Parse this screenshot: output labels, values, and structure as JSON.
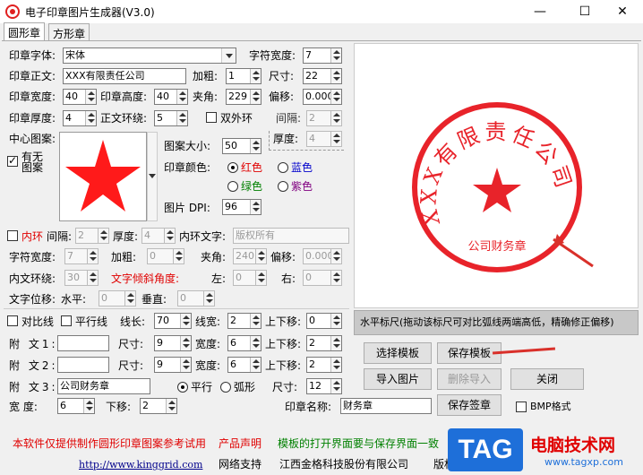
{
  "window": {
    "title": "电子印章图片生成器(V3.0)",
    "minimize": "—",
    "maximize": "☐",
    "close": "✕"
  },
  "tabs": [
    "圆形章",
    "方形章"
  ],
  "row1": {
    "font_label": "印章字体:",
    "font_value": "宋体",
    "charwidth_label": "字符宽度:",
    "charwidth_value": "7"
  },
  "row2": {
    "text_label": "印章正文:",
    "text_value": "XXX有限责任公司",
    "bold_label": "加粗:",
    "bold_value": "1",
    "size_label": "尺寸:",
    "size_value": "22"
  },
  "row3": {
    "width_label": "印章宽度:",
    "width_value": "40",
    "height_label": "印章高度:",
    "height_value": "40",
    "angle_label": "夹角:",
    "angle_value": "229",
    "offset_label": "偏移:",
    "offset_value": "0.000"
  },
  "row4": {
    "thick_label": "印章厚度:",
    "thick_value": "4",
    "ring_label": "正文环绕:",
    "ring_value": "5",
    "double_label": "双外环",
    "gap_label": "间隔:",
    "gap_value": "2"
  },
  "center": {
    "label": "中心图案:",
    "has_label": "有无",
    "pattern_label": "图案",
    "size_label": "图案大小:",
    "size_value": "50",
    "thick_label": "厚度:",
    "thick_value": "4",
    "color_label": "印章颜色:",
    "red": "红色",
    "blue": "蓝色",
    "green": "绿色",
    "purple": "紫色",
    "dpi_label": "图片 DPI:",
    "dpi_value": "96"
  },
  "inner": {
    "label": "内环",
    "gap_label": "间隔:",
    "gap_value": "2",
    "thick_label": "厚度:",
    "thick_value": "4",
    "text_label": "内环文字:",
    "text_value": "版权所有",
    "charwidth_label": "字符宽度:",
    "charwidth_value": "7",
    "bold_label": "加粗:",
    "bold_value": "0",
    "angle_label": "夹角:",
    "angle_value": "240",
    "offset_label": "偏移:",
    "offset_value": "0.000",
    "ring_label": "内文环绕:",
    "ring_value": "30",
    "tilt_label": "文字倾斜角度:",
    "left_label": "左:",
    "left_value": "0",
    "right_label": "右:",
    "right_value": "0",
    "shift_label": "文字位移:",
    "h_label": "水平:",
    "h_value": "0",
    "v_label": "垂直:",
    "v_value": "0"
  },
  "lines": {
    "compare_label": "对比线",
    "parallel_label": "平行线",
    "len_label": "线长:",
    "len_value": "70",
    "lw_label": "线宽:",
    "lw_value": "2",
    "ud_label": "上下移:",
    "ud_value": "0"
  },
  "sub1": {
    "label": "附 文1:",
    "size_label": "尺寸:",
    "size_value": "9",
    "width_label": "宽度:",
    "width_value": "6",
    "ud_label": "上下移:",
    "ud_value": "2"
  },
  "sub2": {
    "label": "附 文2:",
    "size_label": "尺寸:",
    "size_value": "9",
    "width_label": "宽度:",
    "width_value": "6",
    "ud_label": "上下移:",
    "ud_value": "2"
  },
  "sub3": {
    "label": "附 文3:",
    "value": "公司财务章",
    "flat_label": "平行",
    "arc_label": "弧形",
    "size_label": "尺寸:",
    "size_value": "12"
  },
  "sub4": {
    "width_label": "宽 度:",
    "width_value": "6",
    "ud_label": "下移:",
    "ud_value": "2",
    "name_label": "印章名称:",
    "name_value": "财务章"
  },
  "buttons": {
    "select_template": "选择模板",
    "save_template": "保存模板",
    "import_image": "导入图片",
    "delete_import": "删除导入",
    "close": "关闭",
    "save_seal": "保存签章",
    "bmp_label": "BMP格式"
  },
  "ruler": "水平标尺(拖动该标尺可对比弧线两端高低，精确修正偏移)",
  "seal": {
    "ring_text": "XXX有限责任公司",
    "bottom_text": "公司财务章",
    "color": "#e8232a"
  },
  "footer": {
    "notice": "本软件仅提供制作圆形印章图案参考试用",
    "statement": "产品声明",
    "template_note": "模板的打开界面要与保存界面一致",
    "url": "http://www.kinggrid.com",
    "support": "网络支持",
    "company": "江西金格科技股份有限公司",
    "rights": "版权"
  },
  "watermark": {
    "logo": "TAG",
    "name": "电脑技术网",
    "url": "www.tagxp.com"
  }
}
